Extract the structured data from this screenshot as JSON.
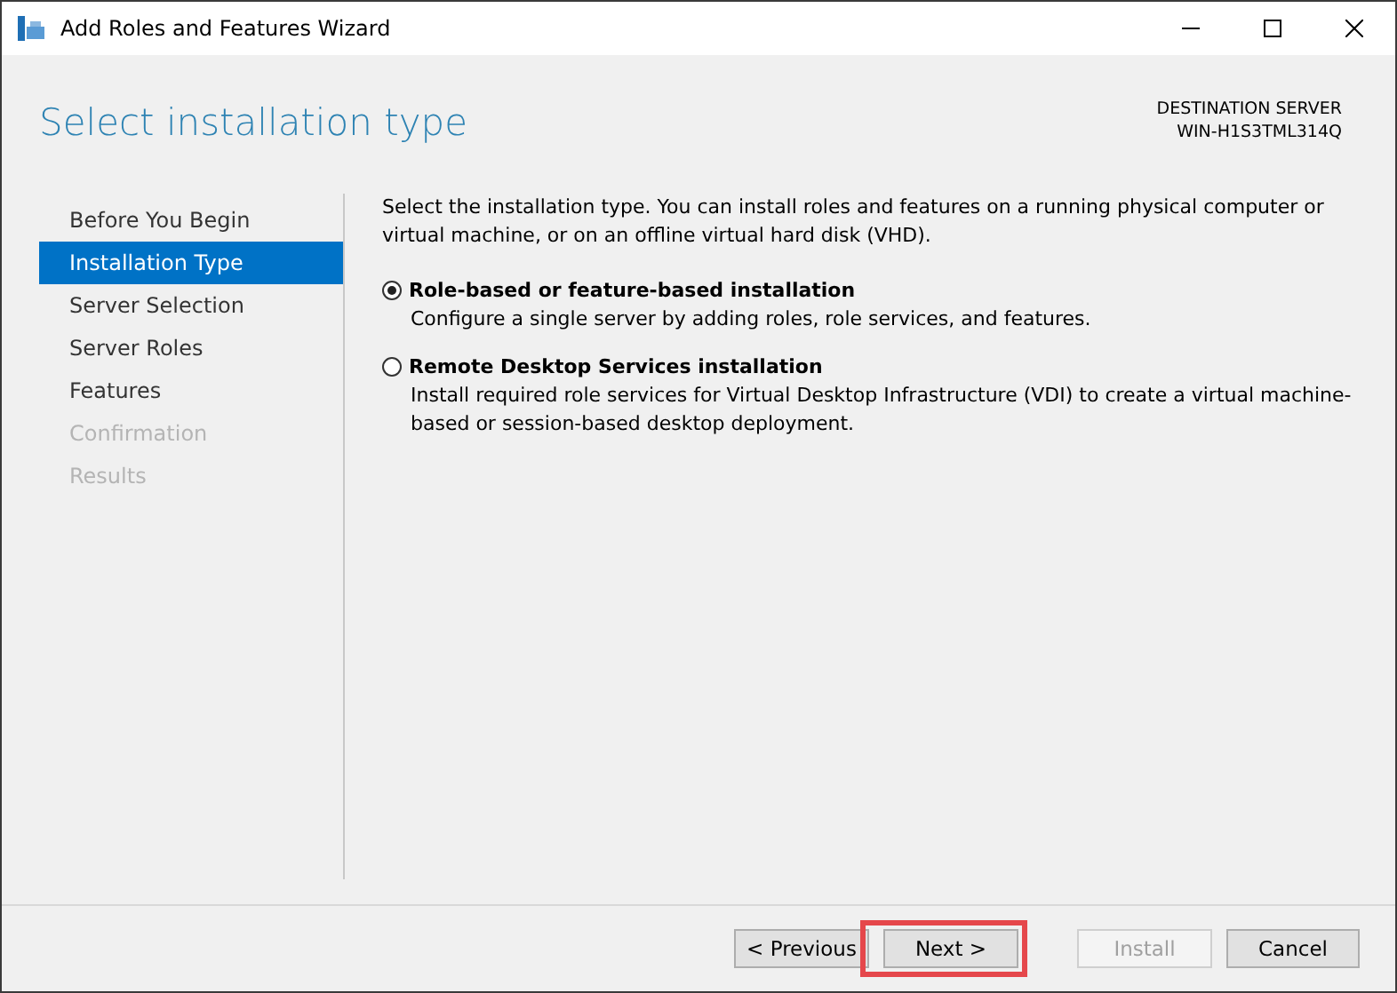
{
  "window": {
    "title": "Add Roles and Features Wizard"
  },
  "header": {
    "title": "Select installation type",
    "destination_label": "DESTINATION SERVER",
    "destination_server": "WIN-H1S3TML314Q"
  },
  "steps": [
    {
      "label": "Before You Begin",
      "selected": false,
      "disabled": false
    },
    {
      "label": "Installation Type",
      "selected": true,
      "disabled": false
    },
    {
      "label": "Server Selection",
      "selected": false,
      "disabled": false
    },
    {
      "label": "Server Roles",
      "selected": false,
      "disabled": false
    },
    {
      "label": "Features",
      "selected": false,
      "disabled": false
    },
    {
      "label": "Confirmation",
      "selected": false,
      "disabled": true
    },
    {
      "label": "Results",
      "selected": false,
      "disabled": true
    }
  ],
  "intro": "Select the installation type. You can install roles and features on a running physical computer or virtual machine, or on an offline virtual hard disk (VHD).",
  "options": [
    {
      "label": "Role-based or feature-based installation",
      "description": "Configure a single server by adding roles, role services, and features.",
      "selected": true
    },
    {
      "label": "Remote Desktop Services installation",
      "description": "Install required role services for Virtual Desktop Infrastructure (VDI) to create a virtual machine-based or session-based desktop deployment.",
      "selected": false
    }
  ],
  "buttons": [
    {
      "label": "< Previous",
      "disabled": false,
      "highlighted": false
    },
    {
      "label": "Next >",
      "disabled": false,
      "highlighted": true
    },
    {
      "label": "Install",
      "disabled": true,
      "highlighted": false
    },
    {
      "label": "Cancel",
      "disabled": false,
      "highlighted": false
    }
  ]
}
